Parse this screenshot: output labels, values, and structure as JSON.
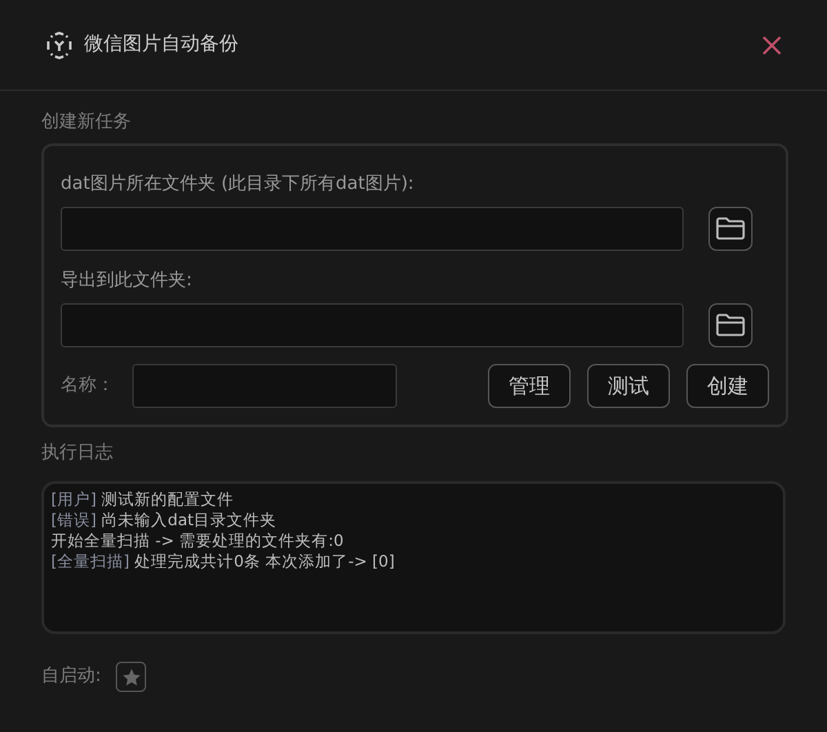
{
  "window": {
    "title": "微信图片自动备份"
  },
  "create_task": {
    "title": "创建新任务",
    "source_label": "dat图片所在文件夹 (此目录下所有dat图片):",
    "target_label": "导出到此文件夹:",
    "name_label": "名称：",
    "buttons": [
      "管理",
      "测试",
      "创建"
    ]
  },
  "log": {
    "title": "执行日志",
    "lines": [
      {
        "tag": "[用户]",
        "text": " 测试新的配置文件"
      },
      {
        "tag": "[错误]",
        "text": " 尚未输入dat目录文件夹"
      },
      {
        "text": "开始全量扫描 -> 需要处理的文件夹有:0"
      },
      {
        "tag": "[全量扫描]",
        "text": " 处理完成共计0条 本次添加了-> [0]"
      }
    ]
  },
  "autostart": {
    "label": "自启动:",
    "checked": false
  }
}
